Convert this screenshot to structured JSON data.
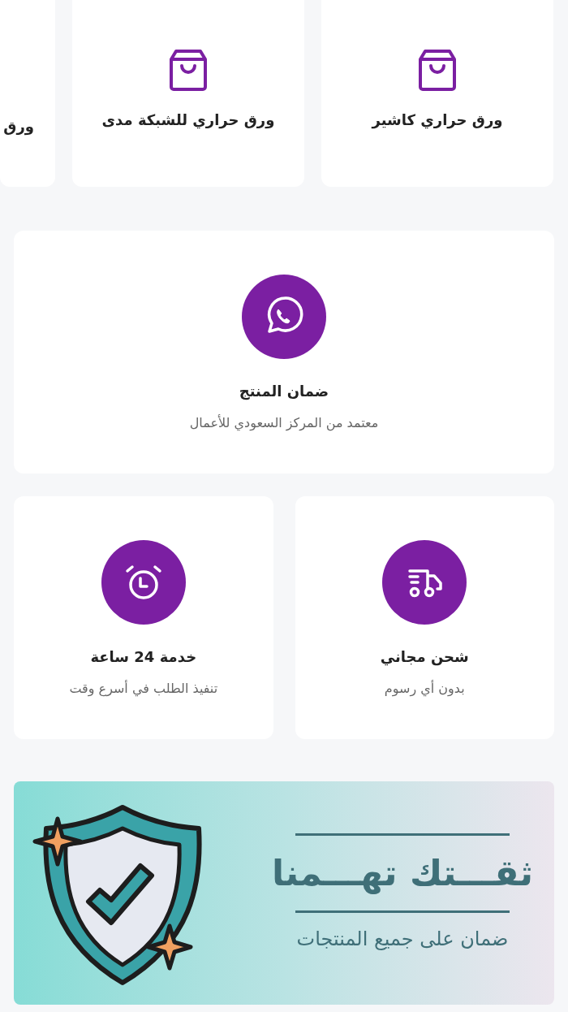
{
  "product_cards": [
    {
      "label": "ورق حراري كاشير",
      "cut_off": false
    },
    {
      "label": "ورق حراري للشبكة مدى",
      "cut_off": false
    },
    {
      "label": "ورق",
      "cut_off": true
    }
  ],
  "featured": {
    "kind": "whatsapp",
    "title": "ضمان المنتج",
    "subtitle": "معتمد من المركز السعودي للأعمال"
  },
  "features": [
    {
      "kind": "truck",
      "title": "شحن مجاني",
      "subtitle": "بدون أي رسوم"
    },
    {
      "kind": "alarm-clock",
      "title": "خدمة 24 ساعة",
      "subtitle": "تنفيذ الطلب في أسرع وقت"
    }
  ],
  "banner": {
    "title": "ثقـــتك تهـــمنا",
    "subtitle": "ضمان على جميع المنتجات"
  }
}
